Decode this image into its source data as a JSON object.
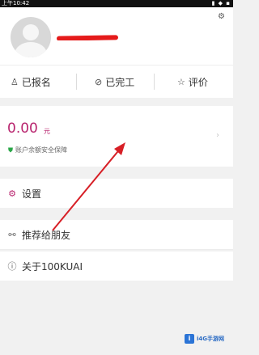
{
  "status_bar": {
    "time": "上午10:42",
    "icons": "▮ ◆ ▪"
  },
  "profile": {
    "username": "",
    "avatar_icon": "person-icon",
    "settings_icon": "gear-icon",
    "settings_glyph": "⚙"
  },
  "stats": [
    {
      "label": "已报名",
      "icon": "person-icon",
      "glyph": "♙"
    },
    {
      "label": "已完工",
      "icon": "check-circle-icon",
      "glyph": "⊘"
    },
    {
      "label": "评价",
      "icon": "star-icon",
      "glyph": "☆"
    }
  ],
  "balance": {
    "amount": "0.00",
    "unit": "元",
    "safety_text": "账户余额安全保障",
    "shield_glyph": "⛊",
    "chevron_glyph": "›"
  },
  "menu": {
    "settings": {
      "label": "设置",
      "glyph": "⚙"
    },
    "share": {
      "label": "推荐给朋友",
      "glyph": "⚯"
    },
    "about": {
      "label": "关于100KUAI",
      "glyph": "ⓘ"
    }
  },
  "watermark": {
    "text": "i4G手游网",
    "logo_glyph": "i"
  },
  "colors": {
    "accent": "#b8246e",
    "annotation_red": "#d71f26",
    "safe_green": "#2aa748"
  }
}
